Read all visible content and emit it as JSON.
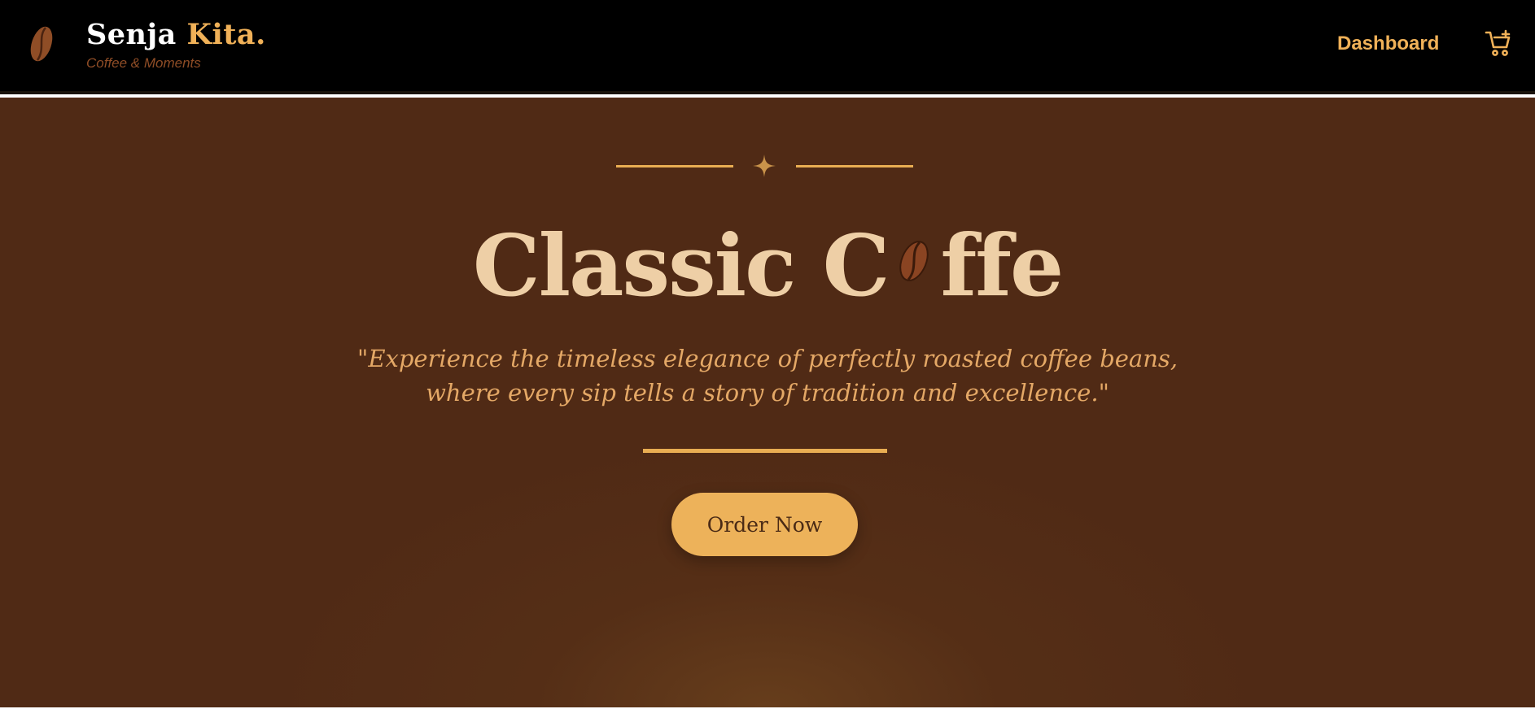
{
  "brand": {
    "name_part1": "Senja",
    "name_part2": "Kita.",
    "tagline": "Coffee & Moments",
    "logo_icon": "coffee-bean-icon"
  },
  "nav": {
    "dashboard_label": "Dashboard",
    "cart_icon": "cart-plus-icon"
  },
  "hero": {
    "ornament_icon": "four-point-star-icon",
    "title_part1": "Classic C",
    "title_bean_icon": "coffee-bean-icon",
    "title_part2": "ffe",
    "quote": "\"Experience the timeless elegance of perfectly roasted coffee beans, where every sip tells a story of tradition and excellence.\"",
    "button_label": "Order Now"
  },
  "colors": {
    "navbar_bg": "#000000",
    "hero_bg": "#502a15",
    "accent": "#f0b158",
    "title_text": "#eecfa6",
    "quote_text": "#e4a866",
    "bean": "#8f4d26"
  }
}
